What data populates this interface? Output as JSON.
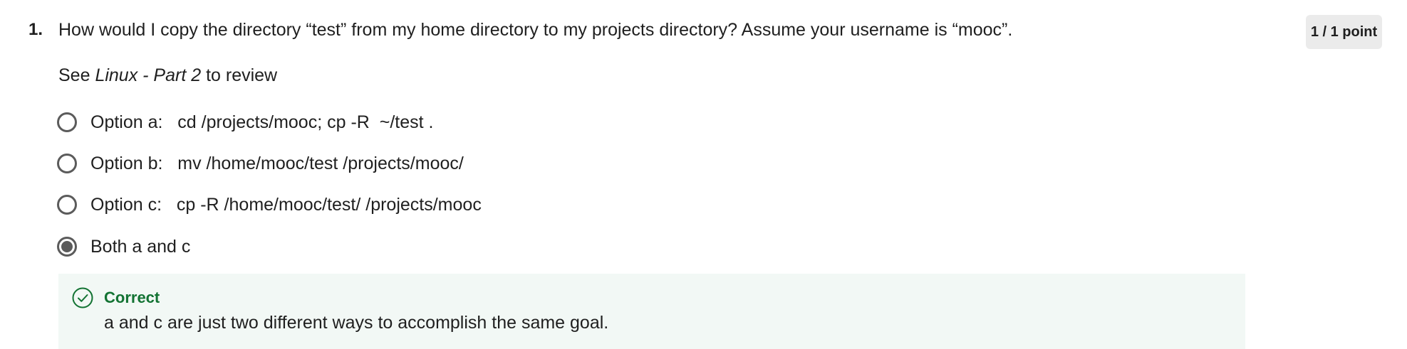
{
  "question": {
    "number": "1.",
    "text": "How would I copy the directory “test” from my home directory to my projects directory?  Assume your username is “mooc”.",
    "score": "1 / 1 point",
    "review_prefix": "See ",
    "review_link": "Linux - Part 2",
    "review_suffix": " to review"
  },
  "options": [
    {
      "label": "Option a:   cd /projects/mooc; cp -R  ~/test .",
      "selected": false
    },
    {
      "label": "Option b:   mv /home/mooc/test /projects/mooc/",
      "selected": false
    },
    {
      "label": "Option c:   cp -R /home/mooc/test/ /projects/mooc",
      "selected": false
    },
    {
      "label": "Both a and c",
      "selected": true
    }
  ],
  "feedback": {
    "title": "Correct",
    "text": "a and c are just two different ways to accomplish the same goal.",
    "icon": "check-circle-icon",
    "accent_color": "#137333",
    "background_color": "#f2f8f5"
  }
}
